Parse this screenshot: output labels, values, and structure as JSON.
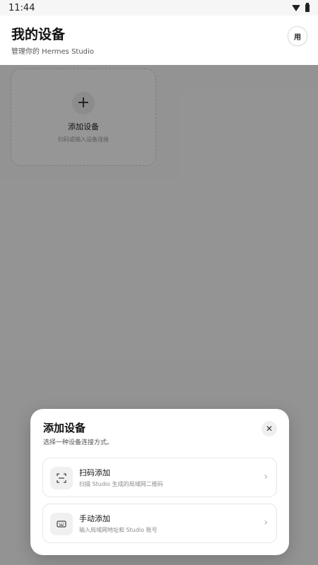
{
  "status_bar": {
    "time": "11:44",
    "icons": [
      "wifi-icon",
      "battery-icon"
    ]
  },
  "header": {
    "title": "我的设备",
    "subtitle": "管理你的 Hermes Studio",
    "avatar_text": "用"
  },
  "add_card": {
    "title": "添加设备",
    "desc": "扫码或输入设备连接",
    "icon": "plus-icon"
  },
  "dialog": {
    "title": "添加设备",
    "subtitle": "选择一种设备连接方式。",
    "close_icon": "close-icon",
    "options": [
      {
        "title": "扫码添加",
        "desc": "扫描 Studio 生成的局域网二维码",
        "icon": "qr-scan-icon"
      },
      {
        "title": "手动添加",
        "desc": "输入局域网地址和 Studio 账号",
        "icon": "keyboard-icon"
      }
    ]
  },
  "colors": {
    "scrim": "#000000",
    "surface": "#ffffff",
    "background": "#f6f6f6"
  }
}
